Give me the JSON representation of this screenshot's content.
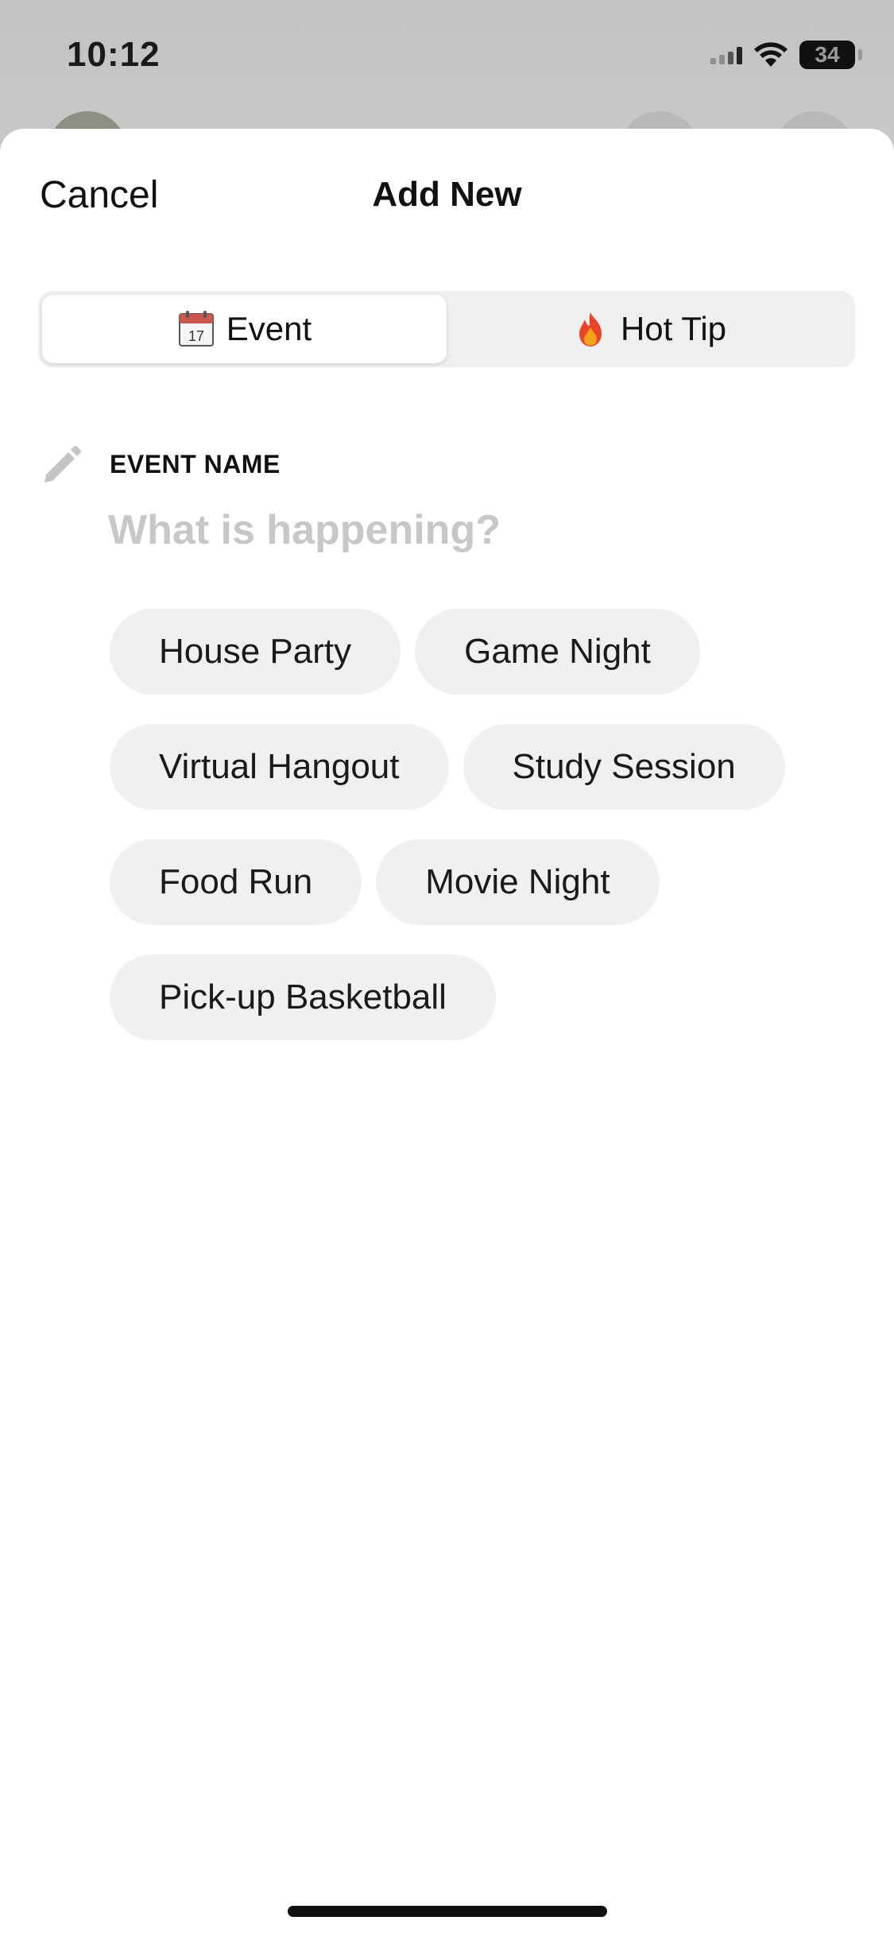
{
  "status_bar": {
    "time": "10:12",
    "battery": "34"
  },
  "header": {
    "cancel_label": "Cancel",
    "title": "Add New"
  },
  "segmented": {
    "options": [
      {
        "label": "Event",
        "icon": "calendar-icon",
        "selected": true
      },
      {
        "label": "Hot Tip",
        "icon": "fire-icon",
        "selected": false
      }
    ]
  },
  "field": {
    "label": "EVENT NAME",
    "placeholder": "What is happening?",
    "value": ""
  },
  "suggestions": [
    "House Party",
    "Game Night",
    "Virtual Hangout",
    "Study Session",
    "Food Run",
    "Movie Night",
    "Pick-up Basketball"
  ],
  "colors": {
    "sheet": "#ffffff",
    "chip": "#f0f0f0",
    "placeholder": "#c7c7c7",
    "backdrop": "#c4c5c3"
  }
}
